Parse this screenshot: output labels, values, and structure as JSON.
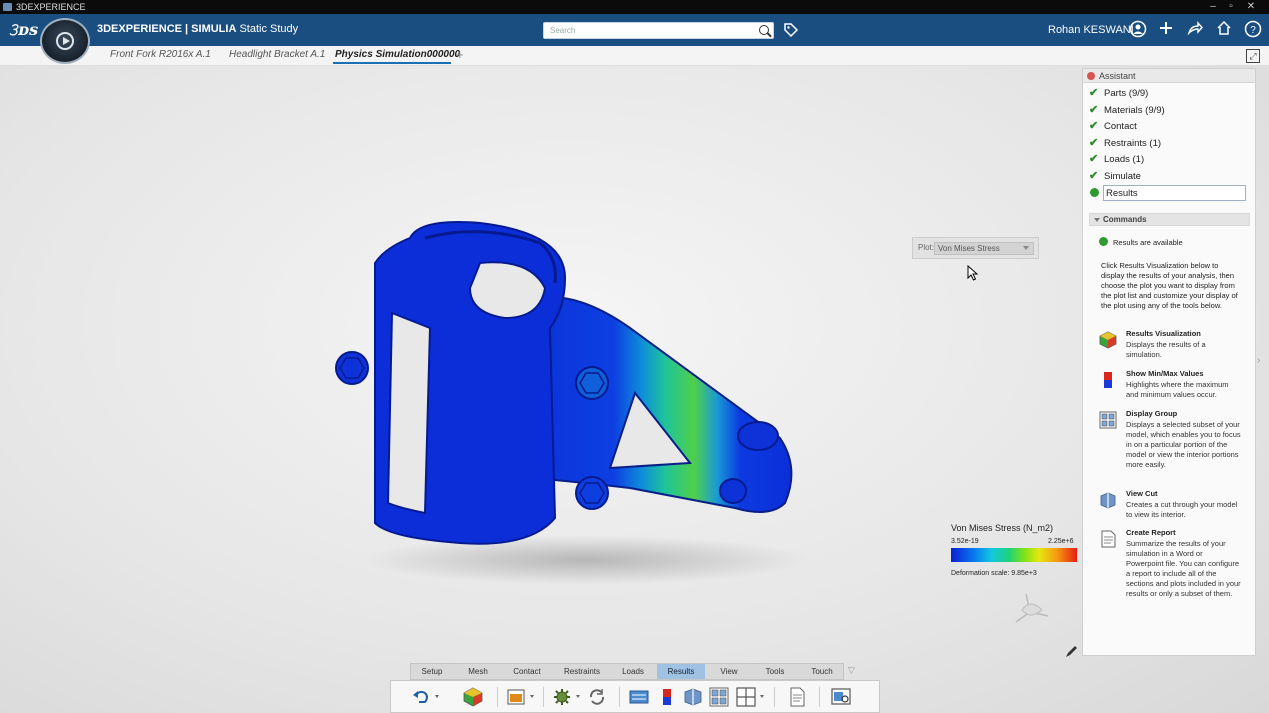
{
  "window": {
    "title": "3DEXPERIENCE",
    "controls": [
      "–",
      "▫",
      "✕"
    ]
  },
  "header": {
    "brand_prefix": "3DEXPERIENCE | ",
    "brand_app": "SIMULIA",
    "brand_suffix": " Static Study",
    "search_placeholder": "Search",
    "user_name": "Rohan KESWANI"
  },
  "tabs": [
    {
      "label": "Front Fork R2016x A.1",
      "active": false
    },
    {
      "label": "Headlight Bracket A.1",
      "active": false
    },
    {
      "label": "Physics Simulation000000",
      "active": true
    }
  ],
  "plot": {
    "label": "Plot:",
    "selected": "Von Mises Stress"
  },
  "legend": {
    "title": "Von Mises Stress (N_m2)",
    "min": "3.52e-19",
    "max": "2.25e+6",
    "deformation": "Deformation scale: 9.85e+3"
  },
  "assistant": {
    "title": "Assistant",
    "steps": [
      {
        "label": "Parts (9/9)",
        "done": true
      },
      {
        "label": "Materials (9/9)",
        "done": true
      },
      {
        "label": "Contact",
        "done": true
      },
      {
        "label": "Restraints (1)",
        "done": true
      },
      {
        "label": "Loads (1)",
        "done": true
      },
      {
        "label": "Simulate",
        "done": true
      },
      {
        "label": "Results",
        "done": false
      }
    ],
    "commands_header": "Commands",
    "status": "Results are available",
    "intro": "Click Results Visualization below to display the results of your analysis, then choose the plot you want to display from the plot list and customize your display of the plot using any of the tools below.",
    "commands": [
      {
        "title": "Results Visualization",
        "desc": "Displays the results of a simulation.",
        "icon": "results-visualization-icon"
      },
      {
        "title": "Show Min/Max Values",
        "desc": "Highlights where the maximum and minimum values occur.",
        "icon": "min-max-icon"
      },
      {
        "title": "Display Group",
        "desc": "Displays a selected subset of your model, which enables you to focus in on a particular portion of the model or view the interior portions more easily.",
        "icon": "display-group-icon"
      },
      {
        "title": "View Cut",
        "desc": "Creates a cut through your model to view its interior.",
        "icon": "view-cut-icon"
      },
      {
        "title": "Create Report",
        "desc": "Summarize the results of your simulation in a Word or Powerpoint file. You can configure a report to include all of the sections and plots included in your results or only a subset of them.",
        "icon": "report-icon"
      }
    ]
  },
  "action_tabs": [
    {
      "label": "Setup",
      "active": false
    },
    {
      "label": "Mesh",
      "active": false
    },
    {
      "label": "Contact",
      "active": false
    },
    {
      "label": "Restraints",
      "active": false
    },
    {
      "label": "Loads",
      "active": false
    },
    {
      "label": "Results",
      "active": true
    },
    {
      "label": "View",
      "active": false
    },
    {
      "label": "Tools",
      "active": false
    },
    {
      "label": "Touch",
      "active": false
    }
  ],
  "colors": {
    "header_bg": "#1b4e80",
    "accent": "#1b6fb5",
    "check": "#2f8a2f",
    "active_tab": "#9fc2e3"
  }
}
